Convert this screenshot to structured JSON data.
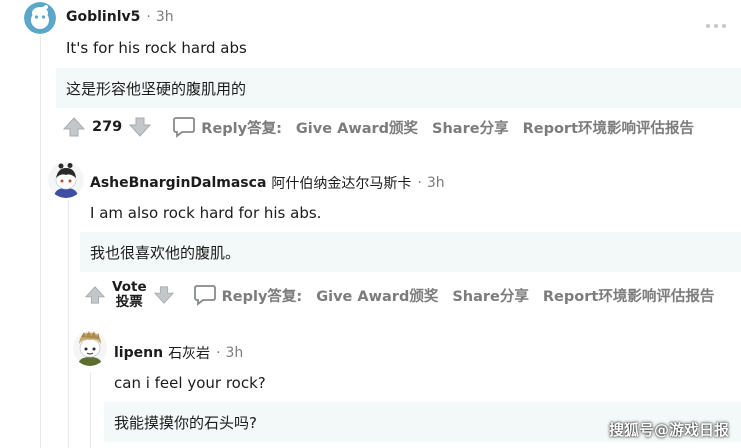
{
  "comments": [
    {
      "username": "Goblinlv5",
      "username_cn": "",
      "time": "3h",
      "text": "It's for his rock hard abs",
      "translation": "这是形容他坚硬的腹肌用的",
      "votes": "279",
      "vote_label_en": "",
      "vote_label_cn": "",
      "reply": "Reply答复:",
      "award": "Give Award颁奖",
      "share": "Share分享",
      "report": "Report环境影响评估报告"
    },
    {
      "username": "AsheBnarginDalmasca",
      "username_cn": "阿什伯纳金达尔马斯卡",
      "time": "3h",
      "text": "I am also rock hard for his abs.",
      "translation": "我也很喜欢他的腹肌。",
      "votes": "",
      "vote_label_en": "Vote",
      "vote_label_cn": "投票",
      "reply": "Reply答复:",
      "award": "Give Award颁奖",
      "share": "Share分享",
      "report": "Report环境影响评估报告"
    },
    {
      "username": "lipenn",
      "username_cn": "石灰岩",
      "time": "3h",
      "text": "can i feel your rock?",
      "translation": "我能摸摸你的石头吗?"
    }
  ],
  "separator": "·",
  "watermark": "搜狐号@游戏日报",
  "colors": {
    "meta_gray": "#7c7c7c",
    "translation_bg": "#f3f9f8",
    "thread_line": "#e6e8e9"
  },
  "icons": [
    "upvote-icon",
    "downvote-icon",
    "comment-bubble-icon",
    "more-options-icon",
    "avatar-icon"
  ]
}
